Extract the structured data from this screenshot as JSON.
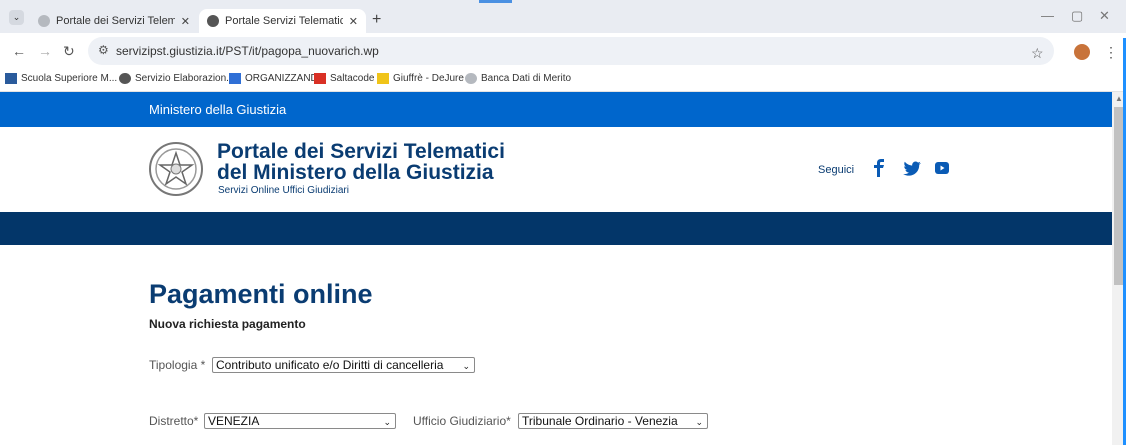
{
  "browser": {
    "tabs": [
      {
        "title": "Portale dei Servizi Telematici de",
        "active": false
      },
      {
        "title": "Portale Servizi Telematici. Richie",
        "active": true
      }
    ],
    "close_glyph": "✕",
    "new_tab_glyph": "+",
    "window_controls": [
      "—",
      "▢",
      "✕"
    ],
    "url": "servizipst.giustizia.it/PST/it/pagopa_nuovarich.wp",
    "bookmarks": [
      "Scuola Superiore M...",
      "Servizio Elaborazion...",
      "ORGANIZZANDO",
      "Saltacode",
      "Giuffrè - DeJure",
      "Banca Dati di Merito"
    ]
  },
  "site": {
    "topbar_title": "Ministero della Giustizia",
    "portal_title_line1": "Portale dei Servizi Telematici",
    "portal_title_line2": "del Ministero della Giustizia",
    "portal_subtitle": "Servizi Online Uffici Giudiziari",
    "follow_label": "Seguici",
    "social_icons": [
      "facebook-icon",
      "twitter-icon",
      "youtube-icon"
    ]
  },
  "form": {
    "page_title": "Pagamenti online",
    "subtitle": "Nuova richiesta pagamento",
    "tipologia_label": "Tipologia *",
    "tipologia_value": "Contributo unificato e/o Diritti di cancelleria",
    "distretto_label": "Distretto*",
    "distretto_value": "VENEZIA",
    "ufficio_label": "Ufficio Giudiziario*",
    "ufficio_value": "Tribunale Ordinario - Venezia"
  },
  "colors": {
    "topbar": "#0066cc",
    "navband": "#033669",
    "title_blue": "#0a3c72"
  }
}
